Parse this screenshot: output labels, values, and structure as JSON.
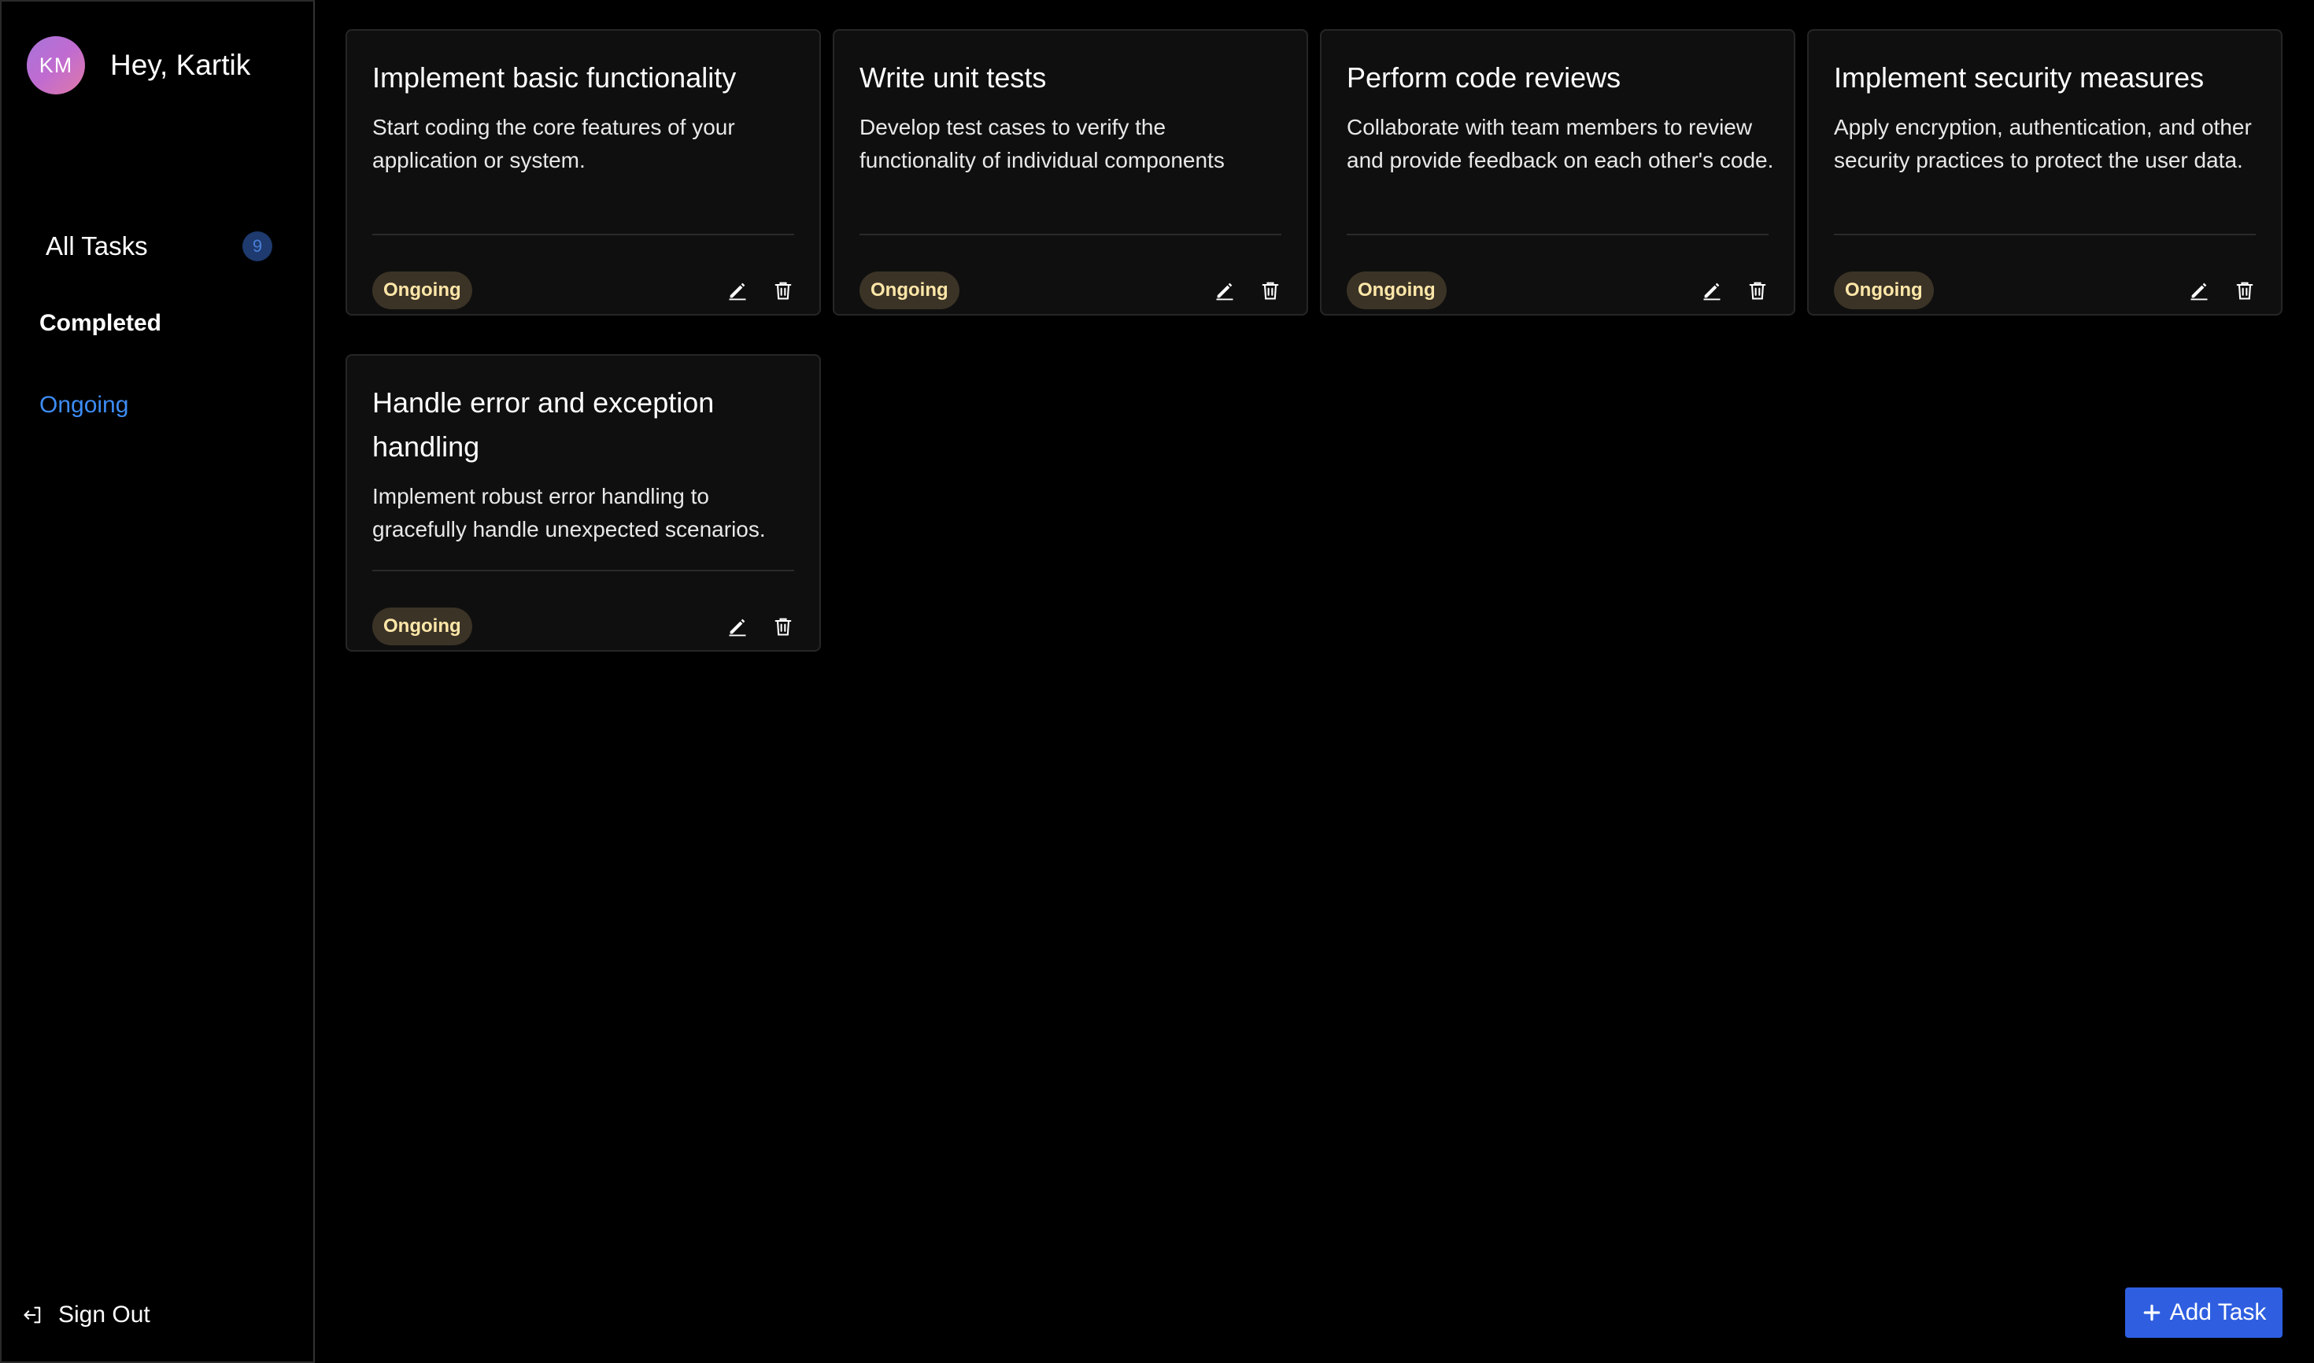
{
  "user": {
    "initials": "KM",
    "greeting": "Hey, Kartik"
  },
  "sidebar": {
    "items": [
      {
        "label": "All Tasks",
        "count": "9"
      },
      {
        "label": "Completed"
      },
      {
        "label": "Ongoing"
      }
    ],
    "signout_label": "Sign Out"
  },
  "tasks": [
    {
      "title": "Implement basic functionality",
      "description": "Start coding the core features of your application or system.",
      "status": "Ongoing"
    },
    {
      "title": "Write unit tests",
      "description": "Develop test cases to verify the functionality of individual components",
      "status": "Ongoing"
    },
    {
      "title": "Perform code reviews",
      "description": "Collaborate with team members to review and provide feedback on each other's code.",
      "status": "Ongoing"
    },
    {
      "title": "Implement security measures",
      "description": "Apply encryption, authentication, and other security practices to protect the user data.",
      "status": "Ongoing"
    },
    {
      "title": "Handle error and exception handling",
      "description": "Implement robust error handling to gracefully handle unexpected scenarios.",
      "status": "Ongoing"
    }
  ],
  "add_button": {
    "label": "Add Task"
  },
  "icons": {
    "edit": "pencil-icon",
    "delete": "trash-icon",
    "signout": "sign-out-icon",
    "add": "plus-icon"
  },
  "colors": {
    "accent": "#2f5fe0",
    "active_nav": "#3d8cf5",
    "status_bg": "#3b3326",
    "status_text": "#ffe7a8"
  }
}
